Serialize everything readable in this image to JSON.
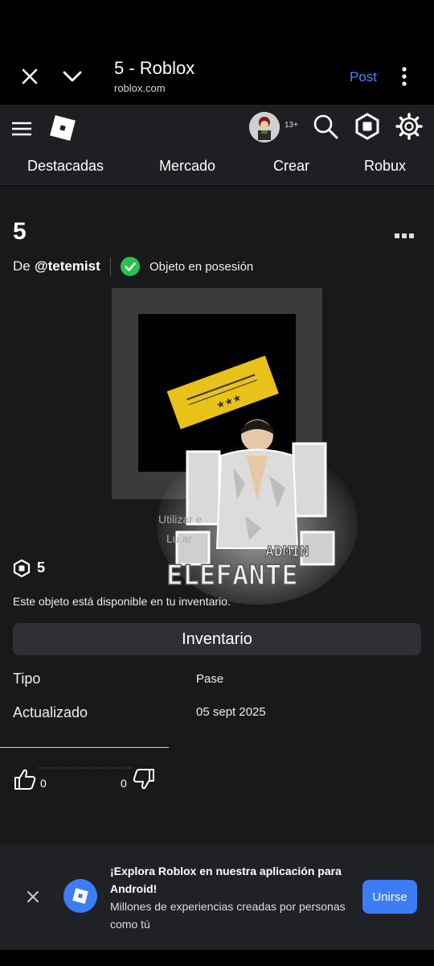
{
  "browser": {
    "title": "5 - Roblox",
    "url": "roblox.com",
    "post_label": "Post",
    "icons": [
      "close-icon",
      "chevron-down-icon",
      "more-vertical-icon"
    ]
  },
  "header": {
    "age_badge": "13+",
    "icons": [
      "hamburger-icon",
      "roblox-logo",
      "avatar",
      "search-icon",
      "robux-icon",
      "gear-icon"
    ],
    "nav": [
      "Destacadas",
      "Mercado",
      "Crear",
      "Robux"
    ]
  },
  "item": {
    "title": "5",
    "creator_prefix": "De",
    "creator_name": "@tetemist",
    "owned_label": "Objeto en posesión",
    "use_label": "Utilizar e",
    "use_label2": "Lu   ar",
    "price": "5",
    "owned_note": "Este objeto está disponible en tu inventario.",
    "inventory_button": "Inventario",
    "details": [
      {
        "label": "Tipo",
        "value": "Pase"
      },
      {
        "label": "Actualizado",
        "value": "05 sept 2025"
      }
    ],
    "likes": "0",
    "dislikes": "0",
    "sticker_text": {
      "top": "ADMIN",
      "main": "ELEFANTE"
    }
  },
  "app_banner": {
    "title": "¡Explora Roblox en nuestra aplicación para Android!",
    "subtitle": "Millones de experiencias creadas por personas como tú",
    "join_label": "Unirse"
  },
  "colors": {
    "background": "#18191b",
    "header": "#1e1f22",
    "accent_blue": "#3d7cf7",
    "check_green": "#27c24c",
    "ticket_yellow": "#e8c21a"
  }
}
